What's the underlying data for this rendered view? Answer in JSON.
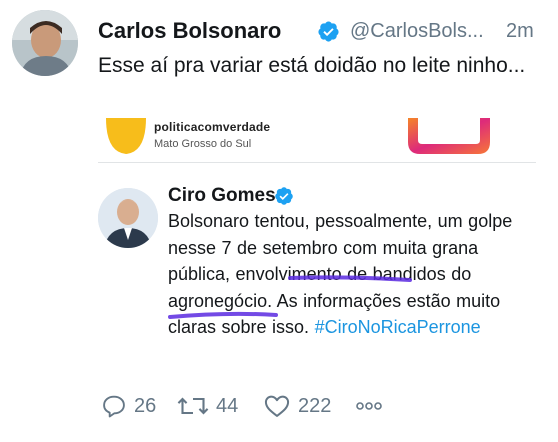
{
  "tweet": {
    "author_name": "Carlos Bolsonaro",
    "handle": "@CarlosBols...",
    "time": "2m",
    "text": "Esse aí pra variar está doidão no leite ninho..."
  },
  "embedded": {
    "top_account": {
      "name": "politicacomverdade",
      "location": "Mato Grosso do Sul"
    },
    "quoted": {
      "author_name": "Ciro Gomes",
      "text_before": "Bolsonaro tentou, pessoalmente, um golpe nesse 7 de setembro com muita grana pública, envolvimento de bandidos do agronegócio. As informações estão muito claras sobre isso. ",
      "hashtag": "#CiroNoRicaPerrone"
    }
  },
  "actions": {
    "replies": "26",
    "retweets": "44",
    "likes": "222"
  },
  "colors": {
    "verified": "#1da1f2",
    "meta_gray": "#657786",
    "hashtag_blue": "#1b95e0",
    "underline_purple": "#5a2ae0",
    "instagram_gradient": "#e1306c"
  },
  "icons": [
    "verified-icon",
    "reply-icon",
    "retweet-icon",
    "like-icon",
    "more-icon"
  ]
}
